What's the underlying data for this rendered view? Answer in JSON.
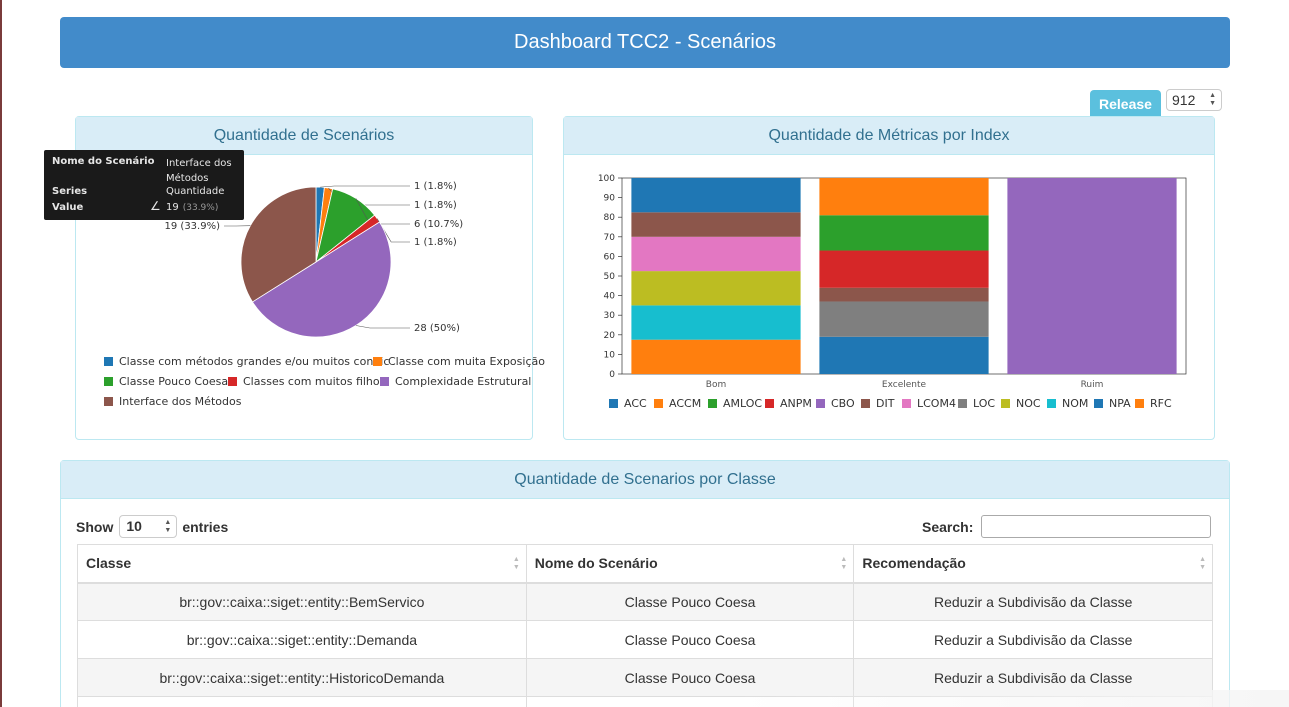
{
  "header": {
    "title": "Dashboard TCC2 - Scenários"
  },
  "release": {
    "label": "Release",
    "selected": "912"
  },
  "pie_panel": {
    "title": "Quantidade de Scenários",
    "tooltip": {
      "name_key": "Nome do Scenário",
      "name_value": "Interface dos Métodos",
      "series_key": "Series",
      "series_value": "Quantidade",
      "value_key": "Value",
      "value_value": "19",
      "value_pct": "(33.9%)"
    },
    "chart_data": {
      "type": "pie",
      "slices": [
        {
          "name": "Classe com métodos grandes e/ou muitos condic",
          "value": 1,
          "label": "1 (1.8%)",
          "color": "#1f77b4"
        },
        {
          "name": "Classe com muita Exposição",
          "value": 1,
          "label": "1 (1.8%)",
          "color": "#ff7f0e"
        },
        {
          "name": "Classe Pouco Coesa",
          "value": 6,
          "label": "6 (10.7%)",
          "color": "#2ca02c"
        },
        {
          "name": "Classes com muitos filhos",
          "value": 1,
          "label": "1 (1.8%)",
          "color": "#d62728"
        },
        {
          "name": "Complexidade Estrutural",
          "value": 28,
          "label": "28 (50%)",
          "color": "#9467bd"
        },
        {
          "name": "Interface dos Métodos",
          "value": 19,
          "label": "19 (33.9%)",
          "color": "#8c564b"
        }
      ]
    }
  },
  "bar_panel": {
    "title": "Quantidade de Métricas por Index",
    "chart_data": {
      "type": "bar",
      "stacked": true,
      "categories": [
        "Bom",
        "Excelente",
        "Ruim"
      ],
      "ylim": [
        0,
        100
      ],
      "yticks": [
        "0",
        "10",
        "20",
        "30",
        "40",
        "50",
        "60",
        "70",
        "80",
        "90",
        "100"
      ],
      "series": [
        {
          "name": "ACC",
          "color": "#1f77b4",
          "values": [
            0,
            0,
            0
          ]
        },
        {
          "name": "ACCM",
          "color": "#ff7f0e",
          "values": [
            0,
            0,
            0
          ]
        },
        {
          "name": "AMLOC",
          "color": "#2ca02c",
          "values": [
            0,
            0,
            0
          ]
        },
        {
          "name": "ANPM",
          "color": "#d62728",
          "values": [
            0,
            0,
            0
          ]
        },
        {
          "name": "CBO",
          "color": "#9467bd",
          "values": [
            0,
            0,
            100
          ]
        },
        {
          "name": "DIT",
          "color": "#8c564b",
          "values": [
            0,
            0,
            0
          ]
        },
        {
          "name": "LCOM4",
          "color": "#e377c2",
          "values": [
            0,
            0,
            0
          ]
        },
        {
          "name": "LOC",
          "color": "#7f7f7f",
          "values": [
            0,
            0,
            0
          ]
        },
        {
          "name": "NOC",
          "color": "#bcbd22",
          "values": [
            0,
            0,
            0
          ]
        },
        {
          "name": "NOM",
          "color": "#17becf",
          "values": [
            0,
            0,
            0
          ]
        },
        {
          "name": "NPA",
          "color": "#1f77b4",
          "values": [
            0,
            0,
            0
          ]
        },
        {
          "name": "RFC",
          "color": "#ff7f0e",
          "values": [
            0,
            0,
            0
          ]
        }
      ],
      "stacks": [
        [
          {
            "color": "#ff7f0e",
            "value": 17.5
          },
          {
            "color": "#17becf",
            "value": 17.5
          },
          {
            "color": "#bcbd22",
            "value": 17.5
          },
          {
            "color": "#e377c2",
            "value": 17.5
          },
          {
            "color": "#8c564b",
            "value": 12.5
          },
          {
            "color": "#1f77b4",
            "value": 17.5
          }
        ],
        [
          {
            "color": "#1f77b4",
            "value": 19
          },
          {
            "color": "#7f7f7f",
            "value": 18
          },
          {
            "color": "#8c564b",
            "value": 7
          },
          {
            "color": "#d62728",
            "value": 19
          },
          {
            "color": "#2ca02c",
            "value": 18
          },
          {
            "color": "#ff7f0e",
            "value": 19
          }
        ],
        [
          {
            "color": "#9467bd",
            "value": 100
          }
        ]
      ]
    }
  },
  "table_panel": {
    "title": "Quantidade de Scenarios por Classe",
    "show_label": "Show",
    "entries_value": "10",
    "entries_label": "entries",
    "search_label": "Search:",
    "columns": [
      "Classe",
      "Nome do Scenário",
      "Recomendação"
    ],
    "rows": [
      [
        "br::gov::caixa::siget::entity::BemServico",
        "Classe Pouco Coesa",
        "Reduzir a Subdivisão da Classe"
      ],
      [
        "br::gov::caixa::siget::entity::Demanda",
        "Classe Pouco Coesa",
        "Reduzir a Subdivisão da Classe"
      ],
      [
        "br::gov::caixa::siget::entity::HistoricoDemanda",
        "Classe Pouco Coesa",
        "Reduzir a Subdivisão da Classe"
      ]
    ]
  }
}
